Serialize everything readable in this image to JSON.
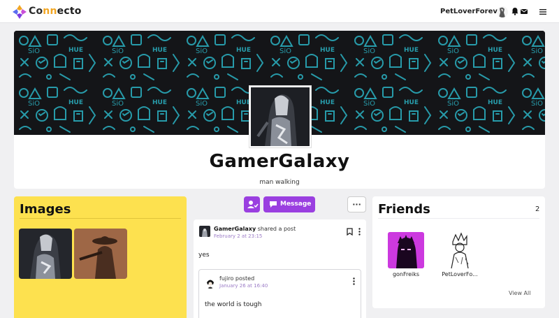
{
  "app": {
    "brand_part1": "Co",
    "brand_part2": "nn",
    "brand_part3": "ecto",
    "accent_color": "#9a3fe0",
    "highlight_color": "#fde14f"
  },
  "nav": {
    "username": "PetLoverForever",
    "icons": [
      "bell-icon",
      "mail-icon",
      "menu-icon"
    ]
  },
  "profile": {
    "name": "GamerGalaxy",
    "bio": "man walking"
  },
  "images_panel": {
    "title": "Images"
  },
  "actions": {
    "message_label": "Message",
    "more_label": "···"
  },
  "post": {
    "author": "GamerGalaxy",
    "action": "shared a post",
    "date": "February 2 at 23:15",
    "text": "yes",
    "shared": {
      "author": "fujiro",
      "action": "posted",
      "date": "January 26 at 16:40",
      "text": "the world is tough"
    }
  },
  "friends_panel": {
    "title": "Friends",
    "count": "2",
    "friends": [
      {
        "name": "gonFreiks"
      },
      {
        "name": "PetLoverFo..."
      }
    ],
    "view_all": "View All"
  }
}
